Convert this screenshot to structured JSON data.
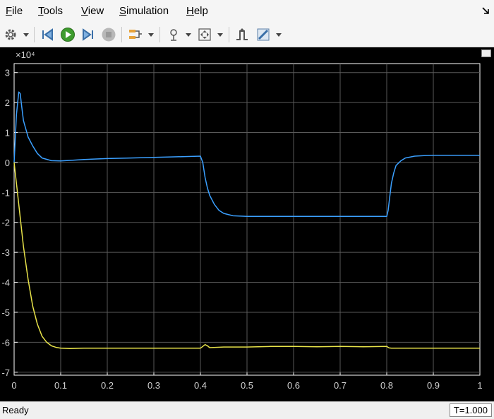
{
  "menu": {
    "items": [
      {
        "label": "File",
        "u": "F",
        "rest": "ile"
      },
      {
        "label": "Tools",
        "u": "T",
        "rest": "ools"
      },
      {
        "label": "View",
        "u": "V",
        "rest": "iew"
      },
      {
        "label": "Simulation",
        "u": "S",
        "rest": "imulation"
      },
      {
        "label": "Help",
        "u": "H",
        "rest": "elp"
      }
    ]
  },
  "toolbar": {
    "icons": [
      "gear-icon",
      "step-back-icon",
      "run-icon",
      "step-forward-icon",
      "stop-icon",
      "signal-select-icon",
      "zoom-icon",
      "fit-to-view-icon",
      "triggers-icon",
      "measurements-icon"
    ]
  },
  "status": {
    "text": "Ready",
    "time": "T=1.000"
  },
  "chart_data": {
    "type": "line",
    "background": "#000000",
    "axis_color": "#ffffff",
    "grid": true,
    "exponent_label": "×10⁴",
    "xlim": [
      0,
      1
    ],
    "ylim": [
      -7.1,
      3.3
    ],
    "xticks": [
      "0",
      "0.1",
      "0.2",
      "0.3",
      "0.4",
      "0.5",
      "0.6",
      "0.7",
      "0.8",
      "0.9",
      "1"
    ],
    "yticks": [
      "3",
      "2",
      "1",
      "0",
      "-1",
      "-2",
      "-3",
      "-4",
      "-5",
      "-6",
      "-7"
    ],
    "series": [
      {
        "color": "#3ba0ff",
        "x": [
          0,
          0.005,
          0.01,
          0.013,
          0.016,
          0.02,
          0.03,
          0.04,
          0.05,
          0.06,
          0.08,
          0.1,
          0.12,
          0.15,
          0.2,
          0.25,
          0.3,
          0.35,
          0.4,
          0.405,
          0.41,
          0.415,
          0.42,
          0.43,
          0.44,
          0.45,
          0.47,
          0.5,
          0.6,
          0.7,
          0.8,
          0.803,
          0.806,
          0.81,
          0.815,
          0.82,
          0.83,
          0.84,
          0.86,
          0.88,
          0.9,
          1.0
        ],
        "y": [
          0,
          1.6,
          2.35,
          2.3,
          1.9,
          1.4,
          0.85,
          0.55,
          0.3,
          0.15,
          0.06,
          0.05,
          0.07,
          0.1,
          0.13,
          0.15,
          0.17,
          0.19,
          0.21,
          0.0,
          -0.5,
          -0.85,
          -1.1,
          -1.4,
          -1.6,
          -1.7,
          -1.78,
          -1.8,
          -1.8,
          -1.8,
          -1.8,
          -1.6,
          -1.2,
          -0.7,
          -0.35,
          -0.1,
          0.05,
          0.15,
          0.21,
          0.23,
          0.24,
          0.24
        ]
      },
      {
        "color": "#e8e34a",
        "x": [
          0,
          0.005,
          0.01,
          0.015,
          0.02,
          0.03,
          0.04,
          0.05,
          0.06,
          0.07,
          0.08,
          0.09,
          0.1,
          0.12,
          0.15,
          0.2,
          0.3,
          0.4,
          0.405,
          0.41,
          0.415,
          0.42,
          0.45,
          0.5,
          0.55,
          0.6,
          0.65,
          0.7,
          0.75,
          0.8,
          0.805,
          0.81,
          0.85,
          0.9,
          1.0
        ],
        "y": [
          0,
          -0.7,
          -1.4,
          -2.1,
          -2.8,
          -3.9,
          -4.8,
          -5.4,
          -5.8,
          -6.0,
          -6.12,
          -6.17,
          -6.2,
          -6.21,
          -6.2,
          -6.2,
          -6.2,
          -6.2,
          -6.14,
          -6.08,
          -6.12,
          -6.18,
          -6.16,
          -6.16,
          -6.14,
          -6.14,
          -6.15,
          -6.14,
          -6.15,
          -6.14,
          -6.19,
          -6.2,
          -6.2,
          -6.2,
          -6.2
        ]
      }
    ]
  }
}
